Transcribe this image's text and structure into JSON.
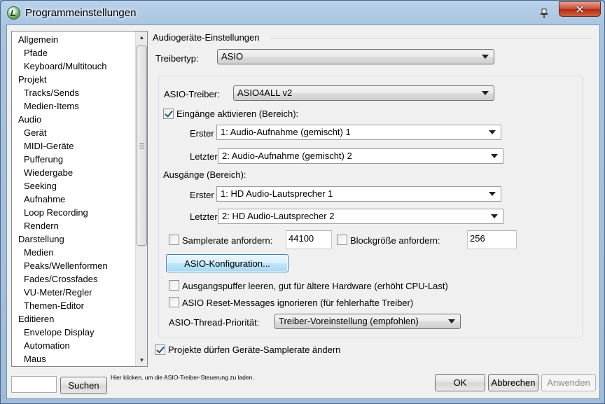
{
  "window": {
    "title": "Programmeinstellungen",
    "close_label": "✕"
  },
  "tree": {
    "items": [
      {
        "label": "Allgemein",
        "level": 0
      },
      {
        "label": "Pfade",
        "level": 1
      },
      {
        "label": "Keyboard/Multitouch",
        "level": 1
      },
      {
        "label": "Projekt",
        "level": 0
      },
      {
        "label": "Tracks/Sends",
        "level": 1
      },
      {
        "label": "Medien-Items",
        "level": 1
      },
      {
        "label": "Audio",
        "level": 0
      },
      {
        "label": "Gerät",
        "level": 1
      },
      {
        "label": "MIDI-Geräte",
        "level": 1
      },
      {
        "label": "Pufferung",
        "level": 1
      },
      {
        "label": "Wiedergabe",
        "level": 1
      },
      {
        "label": "Seeking",
        "level": 1
      },
      {
        "label": "Aufnahme",
        "level": 1
      },
      {
        "label": "Loop Recording",
        "level": 1
      },
      {
        "label": "Rendern",
        "level": 1
      },
      {
        "label": "Darstellung",
        "level": 0
      },
      {
        "label": "Medien",
        "level": 1
      },
      {
        "label": "Peaks/Wellenformen",
        "level": 1
      },
      {
        "label": "Fades/Crossfades",
        "level": 1
      },
      {
        "label": "VU-Meter/Regler",
        "level": 1
      },
      {
        "label": "Themen-Editor",
        "level": 1
      },
      {
        "label": "Editieren",
        "level": 0
      },
      {
        "label": "Envelope Display",
        "level": 1
      },
      {
        "label": "Automation",
        "level": 1
      },
      {
        "label": "Maus",
        "level": 1
      }
    ]
  },
  "bottom": {
    "search_value": "",
    "search_button": "Suchen",
    "hint": "Hier klicken, um die ASIO-Treiber-Steuerung zu laden.",
    "ok": "OK",
    "cancel": "Abbrechen",
    "apply": "Anwenden"
  },
  "audio": {
    "group_title": "Audiogeräte-Einstellungen",
    "driver_type_label": "Treibertyp:",
    "driver_type_value": "ASIO",
    "asio_driver_label": "ASIO-Treiber:",
    "asio_driver_value": "ASIO4ALL v2",
    "inputs_enable_label": "Eingänge aktivieren (Bereich):",
    "inputs_enabled": true,
    "input_first_label": "Erster",
    "input_first_value": "1: Audio-Aufnahme (gemischt) 1",
    "input_last_label": "Letzter",
    "input_last_value": "2: Audio-Aufnahme (gemischt) 2",
    "outputs_label": "Ausgänge (Bereich):",
    "output_first_label": "Erster",
    "output_first_value": "1: HD Audio-Lautsprecher 1",
    "output_last_label": "Letzter",
    "output_last_value": "2: HD Audio-Lautsprecher 2",
    "samplerate_label": "Samplerate anfordern:",
    "samplerate_checked": false,
    "samplerate_value": "44100",
    "blocksize_label": "Blockgröße anfordern:",
    "blocksize_checked": false,
    "blocksize_value": "256",
    "asio_config_button": "ASIO-Konfiguration...",
    "flush_label": "Ausgangspuffer leeren, gut für ältere Hardware (erhöht CPU-Last)",
    "flush_checked": false,
    "reset_label": "ASIO Reset-Messages ignorieren (für fehlerhafte Treiber)",
    "reset_checked": false,
    "thread_priority_label": "ASIO-Thread-Priorität:",
    "thread_priority_value": "Treiber-Voreinstellung (empfohlen)",
    "project_samplerate_label": "Projekte dürfen Geräte-Samplerate ändern",
    "project_samplerate_checked": true
  }
}
